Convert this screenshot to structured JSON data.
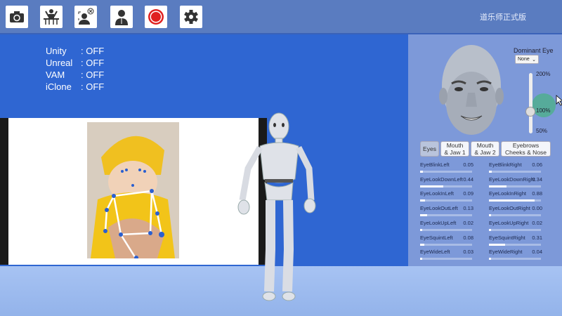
{
  "toolbar": {
    "buttons": [
      {
        "icon": "camera-icon"
      },
      {
        "icon": "mocap-desk-icon"
      },
      {
        "icon": "face-capture-close-icon"
      },
      {
        "icon": "avatar-icon"
      },
      {
        "icon": "record-icon"
      },
      {
        "icon": "gear-icon"
      }
    ]
  },
  "title": "道乐师正式版",
  "status": [
    {
      "name": "Unity",
      "value": ": OFF"
    },
    {
      "name": "Unreal",
      "value": ": OFF"
    },
    {
      "name": "VAM",
      "value": ": OFF"
    },
    {
      "name": "iClone",
      "value": ": OFF"
    }
  ],
  "panel": {
    "dominant_eye_label": "Dominant Eye",
    "dominant_eye_value": "None",
    "scale_max": "200%",
    "scale_mid": "100%",
    "scale_min": "50%",
    "scale_value": 1.0,
    "tabs": [
      "Eyes",
      "Mouth\n& Jaw 1",
      "Mouth\n& Jaw 2",
      "Eyebrows\nCheeks & Nose"
    ],
    "active_tab": "Eyes",
    "blendshapes": [
      {
        "name": "EyeBlinkLeft",
        "value": "0.05"
      },
      {
        "name": "EyeBlinkRight",
        "value": "0.06"
      },
      {
        "name": "EyeLookDownLeft",
        "value": "0.44"
      },
      {
        "name": "EyeLookDownRight",
        "value": "0.34"
      },
      {
        "name": "EyeLookInLeft",
        "value": "0.09"
      },
      {
        "name": "EyeLookInRight",
        "value": "0.88"
      },
      {
        "name": "EyeLookOutLeft",
        "value": "0.13"
      },
      {
        "name": "EyeLookOutRight",
        "value": "0.00"
      },
      {
        "name": "EyeLookUpLeft",
        "value": "0.02"
      },
      {
        "name": "EyeLookUpRight",
        "value": "0.02"
      },
      {
        "name": "EyeSquintLeft",
        "value": "0.08"
      },
      {
        "name": "EyeSquintRight",
        "value": "0.31"
      },
      {
        "name": "EyeWideLeft",
        "value": "0.03"
      },
      {
        "name": "EyeWideRight",
        "value": "0.04"
      }
    ]
  },
  "colors": {
    "topbar": "#5a7cc0",
    "viewport": "#2f66d2",
    "panel": "#7d99d9",
    "record": "#e02020"
  }
}
